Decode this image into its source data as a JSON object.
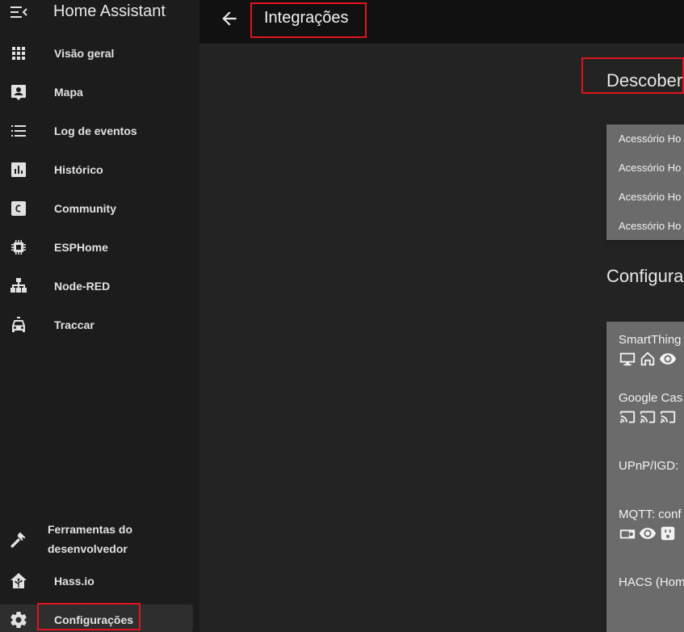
{
  "sidebar": {
    "title": "Home Assistant",
    "items": [
      {
        "label": "Visão geral",
        "icon": "grid-icon"
      },
      {
        "label": "Mapa",
        "icon": "map-account-icon"
      },
      {
        "label": "Log de eventos",
        "icon": "format-list-bulleted-icon"
      },
      {
        "label": "Histórico",
        "icon": "chart-box-icon"
      },
      {
        "label": "Community",
        "icon": "community-c-icon"
      },
      {
        "label": "ESPHome",
        "icon": "chip-icon"
      },
      {
        "label": "Node-RED",
        "icon": "sitemap-icon"
      },
      {
        "label": "Traccar",
        "icon": "car-icon"
      }
    ],
    "bottom_items": [
      {
        "label": "Ferramentas do desenvolvedor",
        "icon": "hammer-icon"
      },
      {
        "label": "Hass.io",
        "icon": "home-assistant-icon"
      },
      {
        "label": "Configurações",
        "icon": "gear-icon"
      }
    ]
  },
  "header": {
    "title": "Integrações"
  },
  "main": {
    "discovered_title": "Descober",
    "discovered_items": [
      "Acessório Ho",
      "Acessório Ho",
      "Acessório Ho",
      "Acessório Ho"
    ],
    "configured_title": "Configura",
    "configured_items": [
      {
        "title": "SmartThing",
        "icons": [
          "monitor-icon",
          "home-outline-icon",
          "eye-icon"
        ]
      },
      {
        "title": "Google Cas",
        "icons": [
          "cast-icon",
          "cast-icon",
          "cast-icon"
        ]
      },
      {
        "title": "UPnP/IGD:",
        "icons": []
      },
      {
        "title": "MQTT: conf",
        "icons": [
          "radio-device-icon",
          "eye-icon",
          "power-socket-icon"
        ]
      },
      {
        "title": "HACS (Hom",
        "icons": []
      }
    ]
  },
  "colors": {
    "sidebar_bg": "#1c1c1c",
    "topbar_bg": "#111111",
    "card_bg": "#6b6b6b",
    "highlight": "#e0141e"
  }
}
